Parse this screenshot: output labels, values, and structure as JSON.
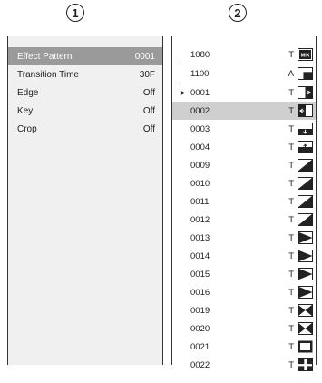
{
  "markers": [
    "1",
    "2"
  ],
  "left_menu": [
    {
      "name": "Effect Pattern",
      "value": "0001",
      "selected": true
    },
    {
      "name": "Transition Time",
      "value": "30F",
      "selected": false
    },
    {
      "name": "Edge",
      "value": "Off",
      "selected": false
    },
    {
      "name": "Key",
      "value": "Off",
      "selected": false
    },
    {
      "name": "Crop",
      "value": "Off",
      "selected": false
    }
  ],
  "pattern_list": [
    {
      "num": "1080",
      "type": "T",
      "icon": "mix-icon",
      "label": "MIX",
      "current": false,
      "selected": false
    },
    {
      "num": "1100",
      "type": "A",
      "icon": "corner-wipe-icon",
      "current": false,
      "selected": false
    },
    {
      "num": "0001",
      "type": "T",
      "icon": "wipe-right-icon",
      "current": true,
      "selected": false
    },
    {
      "num": "0002",
      "type": "T",
      "icon": "wipe-left-icon",
      "current": false,
      "selected": true
    },
    {
      "num": "0003",
      "type": "T",
      "icon": "wipe-down-icon",
      "current": false,
      "selected": false
    },
    {
      "num": "0004",
      "type": "T",
      "icon": "wipe-up-icon",
      "current": false,
      "selected": false
    },
    {
      "num": "0009",
      "type": "T",
      "icon": "diagonal-wipe-icon",
      "current": false,
      "selected": false
    },
    {
      "num": "0010",
      "type": "T",
      "icon": "diagonal-wipe-icon",
      "current": false,
      "selected": false
    },
    {
      "num": "0011",
      "type": "T",
      "icon": "diagonal-wipe-icon",
      "current": false,
      "selected": false
    },
    {
      "num": "0012",
      "type": "T",
      "icon": "diagonal-wipe-icon",
      "current": false,
      "selected": false
    },
    {
      "num": "0013",
      "type": "T",
      "icon": "wedge-wipe-icon",
      "current": false,
      "selected": false
    },
    {
      "num": "0014",
      "type": "T",
      "icon": "wedge-wipe-icon",
      "current": false,
      "selected": false
    },
    {
      "num": "0015",
      "type": "T",
      "icon": "wedge-wipe-icon",
      "current": false,
      "selected": false
    },
    {
      "num": "0016",
      "type": "T",
      "icon": "wedge-wipe-icon",
      "current": false,
      "selected": false
    },
    {
      "num": "0019",
      "type": "T",
      "icon": "x-wipe-icon",
      "current": false,
      "selected": false
    },
    {
      "num": "0020",
      "type": "T",
      "icon": "x-wipe-icon",
      "current": false,
      "selected": false
    },
    {
      "num": "0021",
      "type": "T",
      "icon": "box-wipe-icon",
      "current": false,
      "selected": false
    },
    {
      "num": "0022",
      "type": "T",
      "icon": "corner-box-wipe-icon",
      "current": false,
      "selected": false
    }
  ],
  "current_marker": "►"
}
